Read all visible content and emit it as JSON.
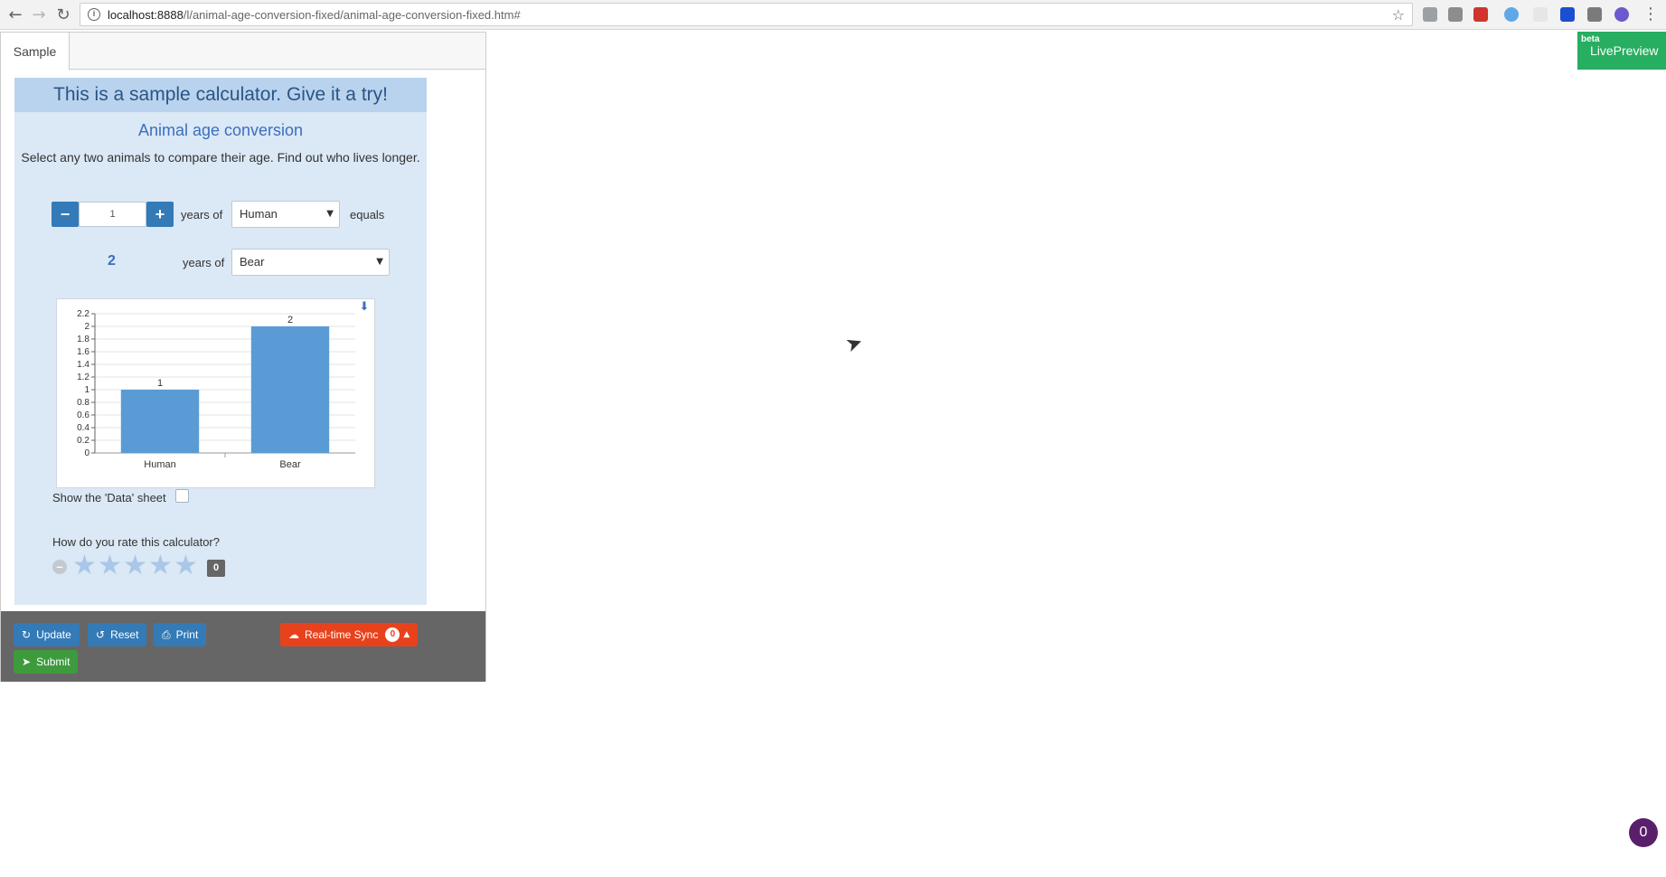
{
  "browser": {
    "url_host": "localhost:8888",
    "url_path": "/l/animal-age-conversion-fixed/animal-age-conversion-fixed.htm#"
  },
  "tabs": [
    {
      "label": "Sample"
    }
  ],
  "calculator": {
    "heading": "This is a sample calculator. Give it a try!",
    "title": "Animal age conversion",
    "description": "Select any two animals to compare their age. Find out who lives longer.",
    "input_value": "1",
    "years_of_label": "years of",
    "equals_label": "equals",
    "from_animal": "Human",
    "to_animal": "Bear",
    "result_value": "2",
    "show_data_label": "Show the 'Data' sheet",
    "rate_question": "How do you rate this calculator?",
    "rating_count": "0",
    "rating": {
      "value": 0,
      "max": 5
    }
  },
  "chart_data": {
    "type": "bar",
    "categories": [
      "Human",
      "Bear"
    ],
    "values": [
      1,
      2
    ],
    "data_labels": [
      "1",
      "2"
    ],
    "ylim": [
      0,
      2.2
    ],
    "yticks": [
      "0",
      "0.2",
      "0.4",
      "0.6",
      "0.8",
      "1",
      "1.2",
      "1.4",
      "1.6",
      "1.8",
      "2",
      "2.2"
    ],
    "grid": true,
    "bar_color": "#5b9bd5"
  },
  "toolbar": {
    "update_label": "Update",
    "reset_label": "Reset",
    "print_label": "Print",
    "sync_label": "Real-time Sync",
    "sync_count": "0",
    "submit_label": "Submit"
  },
  "livepreview": {
    "beta": "beta",
    "label": "LivePreview"
  },
  "chat_bubble": {
    "count": "0"
  },
  "colors": {
    "accent_blue": "#337ab7",
    "submit_green": "#3d9b3d",
    "sync_red": "#e8421d",
    "livepreview_green": "#27ae60"
  }
}
